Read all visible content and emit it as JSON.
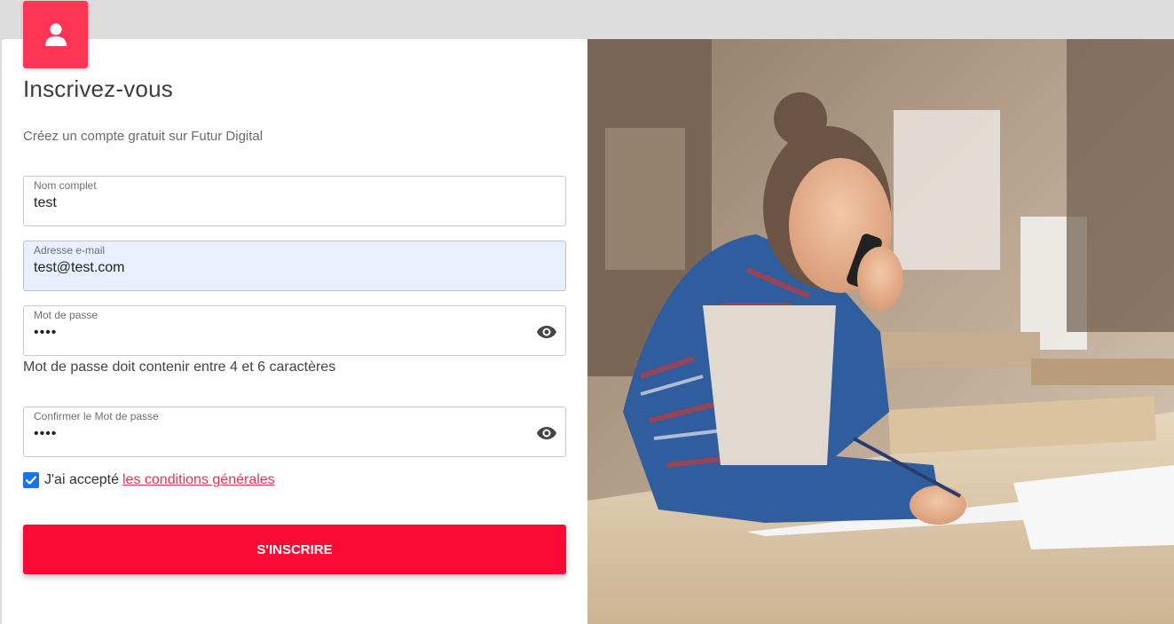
{
  "form": {
    "title": "Inscrivez-vous",
    "subtitle": "Créez un compte gratuit sur Futur Digital",
    "fields": {
      "fullname": {
        "label": "Nom complet",
        "value": "test"
      },
      "email": {
        "label": "Adresse e-mail",
        "value": "test@test.com"
      },
      "password": {
        "label": "Mot de passe",
        "value": "••••"
      },
      "confirm": {
        "label": "Confirmer le Mot de passe",
        "value": "••••"
      }
    },
    "password_hint": "Mot de passe doit contenir entre 4 et 6 caractères",
    "terms": {
      "prefix": "J'ai accepté",
      "link": "les conditions générales",
      "checked": true
    },
    "submit_label": "S'INSCRIRE"
  },
  "icons": {
    "avatar": "user-icon",
    "password_toggle": "eye-icon",
    "checkbox": "check-icon"
  },
  "colors": {
    "accent": "#ff3556",
    "button": "#fa0a35",
    "link": "#e8334f",
    "checkbox": "#1a73e8",
    "autofill": "#e8f0fe"
  }
}
